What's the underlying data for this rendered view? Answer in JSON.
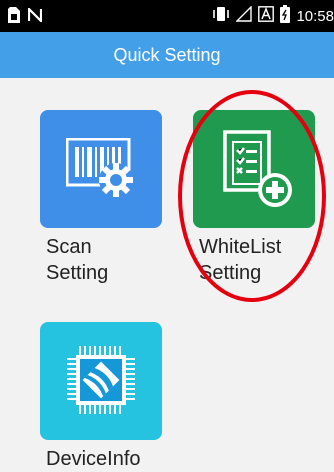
{
  "status_bar": {
    "time": "10:58",
    "icons": [
      "sim-icon",
      "n-icon",
      "vibrate-icon",
      "signal-icon",
      "a-icon",
      "battery-icon"
    ]
  },
  "app_bar": {
    "title": "Quick Setting"
  },
  "tiles": [
    {
      "label": "Scan\nSetting",
      "icon": "barcode-gear-icon"
    },
    {
      "label": "WhiteList\nSetting",
      "icon": "list-add-icon"
    },
    {
      "label": "DeviceInfo",
      "icon": "chip-icon"
    }
  ],
  "colors": {
    "app_bar": "#43a0e8",
    "scan_tile": "#3f8fe8",
    "whitelist_tile": "#1f9a4f",
    "device_tile": "#25c3df",
    "highlight": "#e4000f"
  }
}
